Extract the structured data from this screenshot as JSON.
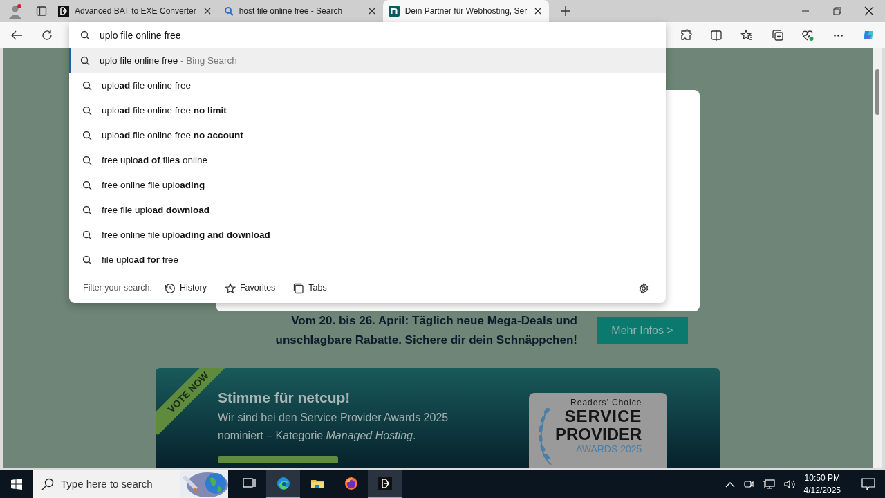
{
  "tabs": [
    {
      "kind": "app",
      "title": "Advanced BAT to EXE Converter",
      "selected": false
    },
    {
      "kind": "search",
      "title": "host file online free - Search",
      "selected": false
    },
    {
      "kind": "site",
      "title": "Dein Partner für Webhosting, Ser",
      "selected": true
    }
  ],
  "omnibox": {
    "value": "uplo file online free",
    "suggestions": [
      {
        "text": "uplo file online free",
        "suffix": "- Bing Search",
        "selected": true
      },
      {
        "text": "uplo**ad** file online free",
        "selected": false
      },
      {
        "text": "uplo**ad** file online free **no limit**",
        "selected": false
      },
      {
        "text": "uplo**ad** file online free **no account**",
        "selected": false
      },
      {
        "text": "free uplo**ad of** file**s** online",
        "selected": false
      },
      {
        "text": "free online file uplo**ading**",
        "selected": false
      },
      {
        "text": "free file uplo**ad download**",
        "selected": false
      },
      {
        "text": "free online file uplo**ading and download**",
        "selected": false
      },
      {
        "text": "file uplo**ad for** free",
        "selected": false
      }
    ],
    "filter_label": "Filter your search:",
    "filters": [
      {
        "kind": "history",
        "label": "History"
      },
      {
        "kind": "favorites",
        "label": "Favorites"
      },
      {
        "kind": "tabs",
        "label": "Tabs"
      }
    ]
  },
  "page": {
    "promo_text": "Vom 20. bis 26. April: Täglich neue Mega-Deals und unschlagbare Rabatte. Sichere dir dein Schnäppchen!",
    "promo_button": "Mehr Infos >",
    "banner": {
      "ribbon": "VOTE NOW",
      "heading": "Stimme für netcup!",
      "text": "Wir sind bei den Service Provider Awards 2025 nominiert – Kategorie *Managed Hosting*.",
      "award": {
        "line_1": "Readers’ Choice",
        "line_2": "SERVICE",
        "line_3": "PROVIDER",
        "line_4": "AWARDS 2025"
      }
    }
  },
  "taskbar": {
    "search_placeholder": "Type here to search",
    "apps": [
      {
        "kind": "taskview",
        "active": false
      },
      {
        "kind": "edge",
        "active": true
      },
      {
        "kind": "explorer",
        "active": false
      },
      {
        "kind": "firefox",
        "active": false
      },
      {
        "kind": "bat",
        "active": true
      }
    ],
    "time": "10:50 PM",
    "date": "4/12/2025"
  }
}
